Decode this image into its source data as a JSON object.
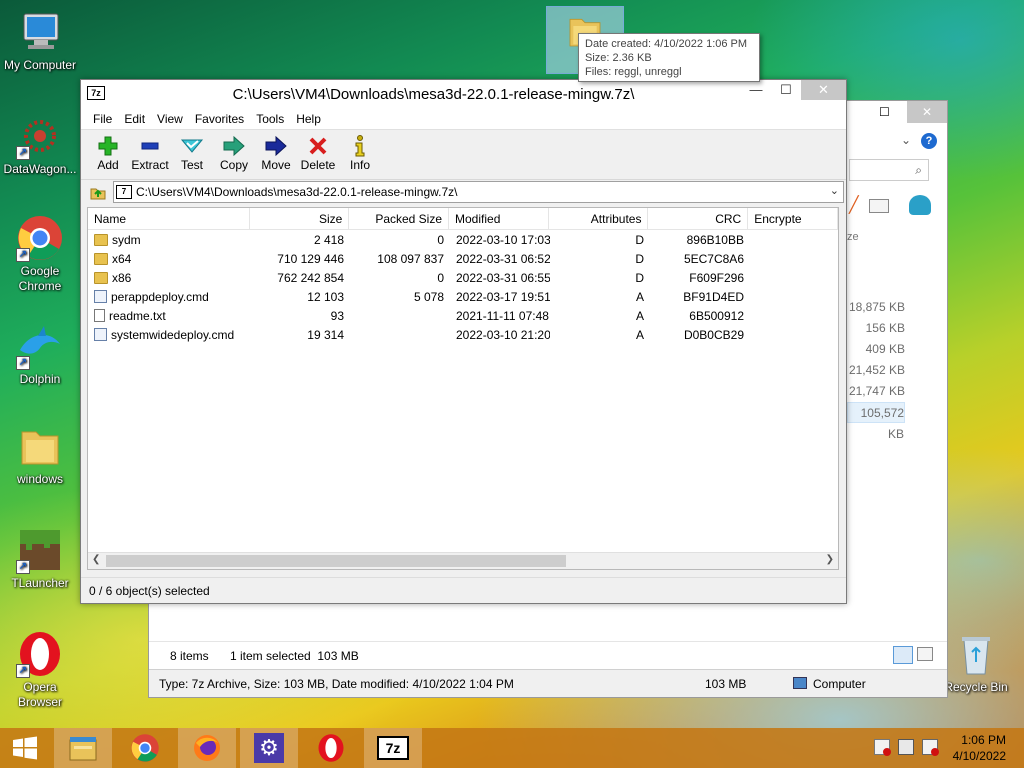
{
  "desktop_icons": [
    {
      "label": "My Computer",
      "icon": "computer-icon"
    },
    {
      "label": "DataWagon...",
      "icon": "datawagon-icon"
    },
    {
      "label": "Google Chrome",
      "icon": "chrome-icon"
    },
    {
      "label": "Dolphin",
      "icon": "dolphin-icon"
    },
    {
      "label": "windows",
      "icon": "folder-icon"
    },
    {
      "label": "TLauncher",
      "icon": "minecraft-icon"
    },
    {
      "label": "Opera Browser",
      "icon": "opera-icon"
    },
    {
      "label": "Recycle Bin",
      "icon": "recycle-bin-icon"
    }
  ],
  "tooltip": {
    "line1": "Date created: 4/10/2022 1:06 PM",
    "line2": "Size: 2.36 KB",
    "line3": "Files: reggl, unreggl"
  },
  "sevenzip": {
    "title": "C:\\Users\\VM4\\Downloads\\mesa3d-22.0.1-release-mingw.7z\\",
    "menu": [
      "File",
      "Edit",
      "View",
      "Favorites",
      "Tools",
      "Help"
    ],
    "toolbar": [
      "Add",
      "Extract",
      "Test",
      "Copy",
      "Move",
      "Delete",
      "Info"
    ],
    "address": "C:\\Users\\VM4\\Downloads\\mesa3d-22.0.1-release-mingw.7z\\",
    "columns": [
      "Name",
      "Size",
      "Packed Size",
      "Modified",
      "Attributes",
      "CRC",
      "Encrypte"
    ],
    "rows": [
      {
        "type": "folder",
        "name": "sydm",
        "size": "2 418",
        "packed": "0",
        "modified": "2022-03-10 17:03",
        "attr": "D",
        "crc": "896B10BB"
      },
      {
        "type": "folder",
        "name": "x64",
        "size": "710 129 446",
        "packed": "108 097 837",
        "modified": "2022-03-31 06:52",
        "attr": "D",
        "crc": "5EC7C8A6"
      },
      {
        "type": "folder",
        "name": "x86",
        "size": "762 242 854",
        "packed": "0",
        "modified": "2022-03-31 06:55",
        "attr": "D",
        "crc": "F609F296"
      },
      {
        "type": "cmd",
        "name": "perappdeploy.cmd",
        "size": "12 103",
        "packed": "5 078",
        "modified": "2022-03-17 19:51",
        "attr": "A",
        "crc": "BF91D4ED"
      },
      {
        "type": "txt",
        "name": "readme.txt",
        "size": "93",
        "packed": "",
        "modified": "2021-11-11 07:48",
        "attr": "A",
        "crc": "6B500912"
      },
      {
        "type": "cmd",
        "name": "systemwidedeploy.cmd",
        "size": "19 314",
        "packed": "",
        "modified": "2022-03-10 21:20",
        "attr": "A",
        "crc": "D0B0CB29"
      }
    ],
    "status": "0 / 6 object(s) selected"
  },
  "explorer": {
    "size_column_label": "ze",
    "sizes": [
      "18,875 KB",
      "156 KB",
      "409 KB",
      "21,452 KB",
      "21,747 KB",
      "105,572 KB"
    ],
    "items_count": "8 items",
    "selected": "1 item selected  103 MB",
    "details": "Type: 7z Archive, Size: 103 MB, Date modified: 4/10/2022 1:04 PM",
    "details_size": "103 MB",
    "location": "Computer"
  },
  "taskbar": {
    "apps": [
      "explorer-icon",
      "chrome-icon",
      "firefox-icon",
      "settings-icon",
      "opera-icon",
      "7zip-icon"
    ],
    "time": "1:06 PM",
    "date": "4/10/2022"
  }
}
